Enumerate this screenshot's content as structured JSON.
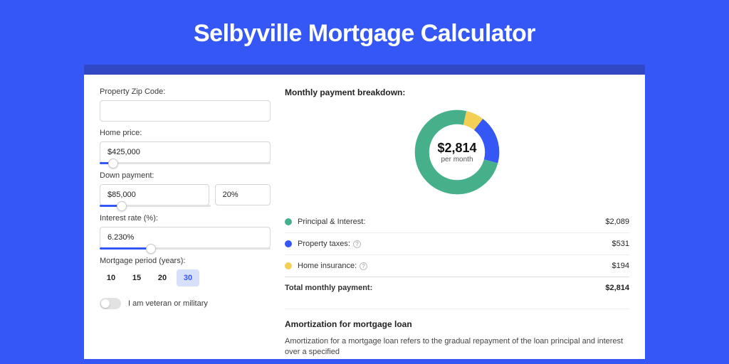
{
  "title": "Selbyville Mortgage Calculator",
  "form": {
    "zip": {
      "label": "Property Zip Code:",
      "value": ""
    },
    "home_price": {
      "label": "Home price:",
      "value": "$425,000",
      "slider_pct": 8
    },
    "down_payment": {
      "label": "Down payment:",
      "amount": "$85,000",
      "pct": "20%",
      "slider_pct": 20
    },
    "interest": {
      "label": "Interest rate (%):",
      "value": "6.230%",
      "slider_pct": 30
    },
    "period": {
      "label": "Mortgage period (years):",
      "options": [
        "10",
        "15",
        "20",
        "30"
      ],
      "selected": "30"
    },
    "veteran": {
      "label": "I am veteran or military",
      "on": false
    }
  },
  "breakdown": {
    "title": "Monthly payment breakdown:",
    "center_amount": "$2,814",
    "center_sub": "per month",
    "items": [
      {
        "label": "Principal & Interest:",
        "value": "$2,089",
        "color": "#46b08a",
        "info": false
      },
      {
        "label": "Property taxes:",
        "value": "$531",
        "color": "#3457f5",
        "info": true
      },
      {
        "label": "Home insurance:",
        "value": "$194",
        "color": "#f3cf55",
        "info": true
      }
    ],
    "total_label": "Total monthly payment:",
    "total_value": "$2,814"
  },
  "chart_data": {
    "type": "pie",
    "title": "Monthly payment breakdown",
    "series": [
      {
        "name": "Principal & Interest",
        "value": 2089,
        "color": "#46b08a"
      },
      {
        "name": "Property taxes",
        "value": 531,
        "color": "#3457f5"
      },
      {
        "name": "Home insurance",
        "value": 194,
        "color": "#f3cf55"
      }
    ],
    "total": 2814,
    "unit": "USD per month"
  },
  "amortization": {
    "title": "Amortization for mortgage loan",
    "text": "Amortization for a mortgage loan refers to the gradual repayment of the loan principal and interest over a specified"
  },
  "colors": {
    "accent": "#3457f5",
    "green": "#46b08a",
    "yellow": "#f3cf55"
  }
}
